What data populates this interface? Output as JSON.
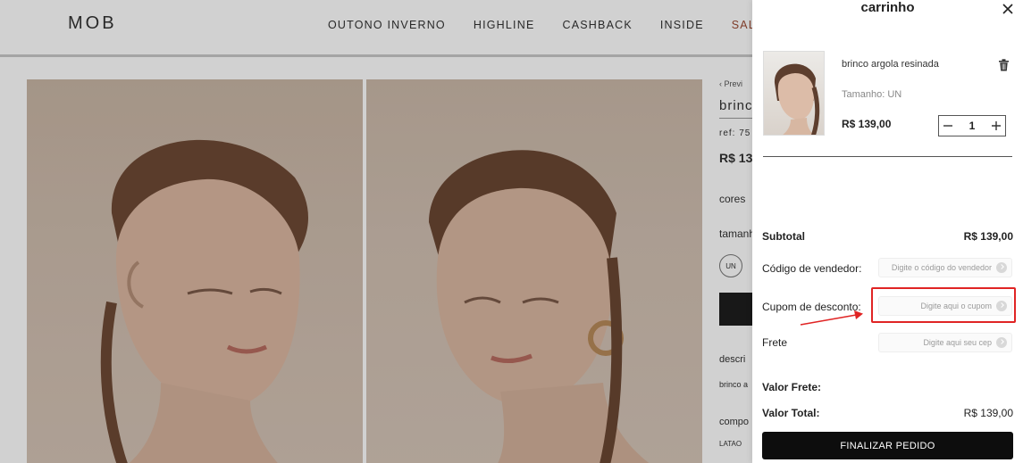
{
  "store": {
    "logo": "MOB",
    "nav": [
      "OUTONO INVERNO",
      "HIGHLINE",
      "CASHBACK",
      "INSIDE",
      "SALE"
    ],
    "product": {
      "breadcrumb": "‹ Previ",
      "name": "brinc",
      "ref": "ref: 75",
      "price": "R$ 13",
      "colors_label": "cores",
      "size_label": "tamanh",
      "size_option": "UN",
      "description_label": "descri",
      "description_text": "brinco a",
      "composition_label": "compo",
      "composition_text": "LATAO"
    }
  },
  "cart": {
    "title": "carrinho",
    "item": {
      "name": "brinco argola resinada",
      "size": "Tamanho: UN",
      "price": "R$ 139,00",
      "quantity": "1"
    },
    "subtotal_label": "Subtotal",
    "subtotal_value": "R$ 139,00",
    "vendor_label": "Código de vendedor:",
    "vendor_placeholder": "Digite o código do vendedor",
    "coupon_label": "Cupom de desconto:",
    "coupon_placeholder": "Digite aqui o cupom",
    "frete_label": "Frete",
    "frete_placeholder": "Digite aqui seu cep",
    "shipping_value_label": "Valor Frete:",
    "total_label": "Valor Total:",
    "total_value": "R$ 139,00",
    "checkout_label": "FINALIZAR PEDIDO"
  },
  "colors": {
    "sale": "#9b4a32",
    "checkout_bg": "#0d0d0d",
    "highlight": "#e02424"
  },
  "icons": [
    "close-icon",
    "trash-icon",
    "minus-icon",
    "plus-icon",
    "arrow-right-icon"
  ]
}
